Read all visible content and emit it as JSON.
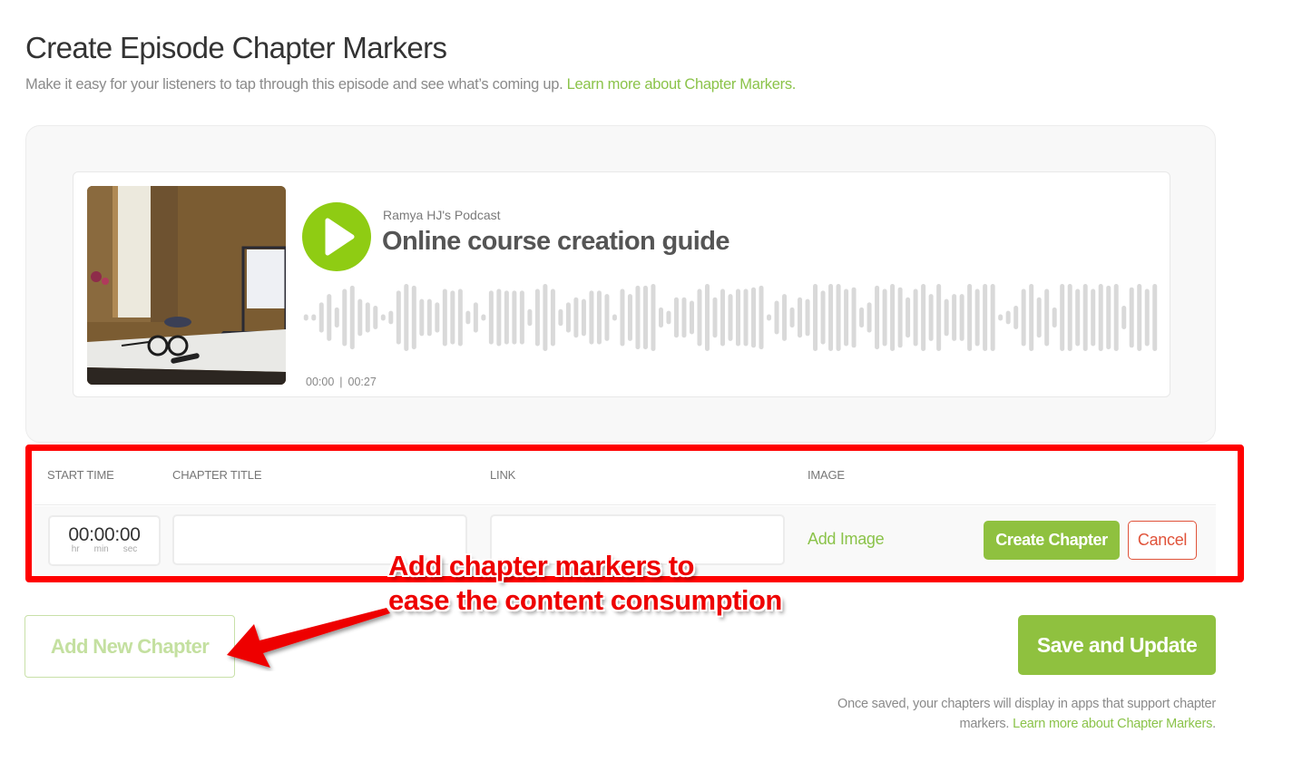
{
  "header": {
    "title": "Create Episode Chapter Markers",
    "subtitle": "Make it easy for your listeners to tap through this episode and see what’s coming up.",
    "learn_more_link": "Learn more about Chapter Markers."
  },
  "player": {
    "podcast_name": "Ramya HJ's Podcast",
    "episode_title": "Online course creation guide",
    "current_time": "00:00",
    "separator": "|",
    "duration": "00:27",
    "play_icon": "play-icon",
    "cover_alt": "desk with glasses, marker and laptop",
    "accent_color": "#8fcc13",
    "waveform_color": "#d9d9d9",
    "waveform_amplitudes": [
      0.08,
      0.08,
      0.45,
      0.7,
      0.3,
      0.85,
      0.95,
      0.55,
      0.45,
      0.35,
      0.08,
      0.2,
      0.8,
      1.0,
      0.95,
      0.55,
      0.55,
      0.45,
      0.85,
      0.8,
      0.85,
      0.2,
      0.45,
      0.08,
      0.8,
      0.85,
      0.8,
      0.8,
      0.8,
      0.25,
      0.85,
      1.0,
      0.85,
      0.25,
      0.45,
      0.6,
      0.55,
      0.8,
      0.8,
      0.7,
      0.08,
      0.85,
      0.7,
      0.95,
      0.95,
      1.0,
      0.3,
      0.2,
      0.6,
      0.6,
      0.5,
      0.85,
      1.0,
      0.6,
      0.85,
      0.7,
      0.85,
      0.85,
      0.9,
      0.95,
      0.08,
      0.5,
      0.7,
      0.3,
      0.6,
      0.55,
      1.0,
      0.8,
      1.0,
      1.0,
      0.85,
      0.9,
      0.3,
      0.45,
      0.95,
      0.85,
      1.0,
      0.9,
      0.6,
      0.85,
      1.0,
      0.7,
      1.0,
      0.55,
      0.7,
      0.7,
      1.0,
      0.85,
      1.0,
      1.0,
      0.08,
      0.2,
      0.35,
      0.85,
      1.0,
      0.6,
      0.85,
      0.3,
      1.0,
      1.0,
      0.85,
      1.0,
      0.85,
      1.0,
      0.95,
      1.0,
      0.35,
      0.9,
      1.0,
      0.85,
      1.0
    ]
  },
  "chapter_form": {
    "columns": {
      "start_time": "START TIME",
      "chapter_title": "CHAPTER TITLE",
      "link": "LINK",
      "image": "IMAGE"
    },
    "start_time_value": "00:00:00",
    "time_units": [
      "hr",
      "min",
      "sec"
    ],
    "chapter_title_value": "",
    "chapter_title_placeholder": "",
    "link_value": "",
    "link_placeholder": "",
    "add_image_label": "Add Image",
    "create_button": "Create Chapter",
    "cancel_button": "Cancel"
  },
  "footer": {
    "add_new_chapter": "Add New Chapter",
    "save_button": "Save and Update",
    "save_note": "Once saved, your chapters will display in apps that support chapter markers.",
    "learn_more_link": "Learn more about Chapter Markers"
  },
  "annotation": {
    "line1": "Add chapter markers to",
    "line2": "ease the content consumption",
    "color": "#ee0000"
  },
  "colors": {
    "brand_green": "#8fc13f",
    "link_green": "#8bc34a",
    "cancel_red": "#e0533a",
    "highlight_red": "#ff0000"
  }
}
